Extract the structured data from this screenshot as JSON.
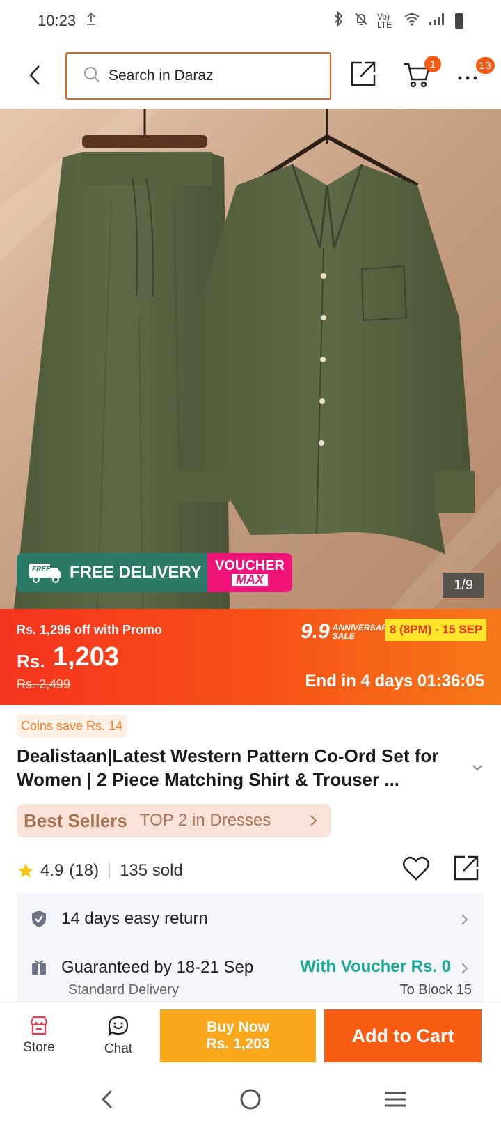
{
  "status_bar": {
    "time": "10:23",
    "upload_icon": "upload-arrow-icon",
    "network": "Vo) LTE"
  },
  "header": {
    "search_placeholder": "Search in Daraz",
    "cart_count": "1",
    "more_count": "13"
  },
  "gallery": {
    "counter": "1/9",
    "free_delivery_tag": "FREE",
    "free_delivery_label": "FREE DELIVERY",
    "voucher_line1": "VOUCHER",
    "voucher_line2": "MAX"
  },
  "price": {
    "promo_text": "Rs. 1,296 off with Promo",
    "currency": "Rs.",
    "current": "1,203",
    "original": "Rs. 2,499",
    "sale_logo": "9.9",
    "sale_logo_sub1": "ANNIVERSARY",
    "sale_logo_sub2": "SALE",
    "sale_dates": "8 (8PM) - 15 SEP",
    "countdown": "End in 4 days 01:36:05"
  },
  "product": {
    "coins_badge": "Coins save Rs. 14",
    "title": "Dealistaan|Latest Western Pattern Co-Ord Set for Women | 2 Piece Matching Shirt & Trouser ...",
    "bestseller_logo": "Best Sellers",
    "bestseller_text": "TOP 2 in Dresses",
    "rating": "4.9",
    "reviews": "(18)",
    "sold": "135 sold"
  },
  "services": {
    "return_text": "14 days easy return",
    "delivery_text": "Guaranteed by 18-21 Sep",
    "voucher_text": "With Voucher Rs. 0",
    "delivery_type": "Standard Delivery",
    "delivery_location": "To Block 15"
  },
  "bottom_bar": {
    "store_label": "Store",
    "chat_label": "Chat",
    "buy_now_label": "Buy Now",
    "buy_now_price": "Rs. 1,203",
    "add_to_cart_label": "Add to Cart"
  },
  "colors": {
    "accent_orange": "#f85c12",
    "buy_now_yellow": "#fba71b",
    "voucher_teal": "#1aab9b",
    "free_delivery_green": "#2b7a66",
    "voucher_pink": "#f0137a"
  }
}
